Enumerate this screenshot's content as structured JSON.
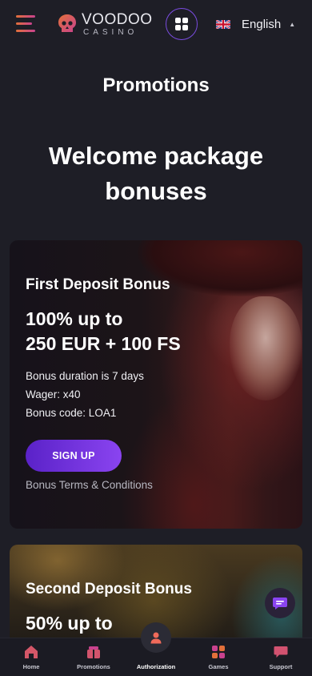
{
  "header": {
    "logo_text": "VOODOO",
    "logo_sub": "CASINO",
    "language": "English",
    "flag_icon": "uk-flag-icon",
    "menu_icon": "hamburger-menu-icon",
    "apps_icon": "grid-apps-icon"
  },
  "page": {
    "title": "Promotions",
    "hero_title": "Welcome package bonuses"
  },
  "cards": [
    {
      "title": "First Deposit Bonus",
      "amount_line1": "100% up to",
      "amount_line2": "250 EUR + 100 FS",
      "details": [
        "Bonus duration is 7 days",
        "Wager: x40",
        "Bonus code: LOA1"
      ],
      "cta_label": "SIGN UP",
      "terms_label": "Bonus Terms & Conditions"
    },
    {
      "title": "Second Deposit Bonus",
      "amount_line1": "50% up to"
    }
  ],
  "bottom_nav": [
    {
      "label": "Home",
      "icon": "home-icon"
    },
    {
      "label": "Promotions",
      "icon": "gift-icon"
    },
    {
      "label": "Authorization",
      "icon": "user-icon",
      "active": true
    },
    {
      "label": "Games",
      "icon": "games-grid-icon"
    },
    {
      "label": "Support",
      "icon": "chat-support-icon"
    }
  ],
  "colors": {
    "background": "#1e1e26",
    "accent_purple": "#7a4ce0",
    "cta_gradient_start": "#5a22c8",
    "cta_gradient_end": "#8a44f0",
    "menu_gradient_start": "#e2703a",
    "menu_gradient_end": "#c9428e"
  }
}
